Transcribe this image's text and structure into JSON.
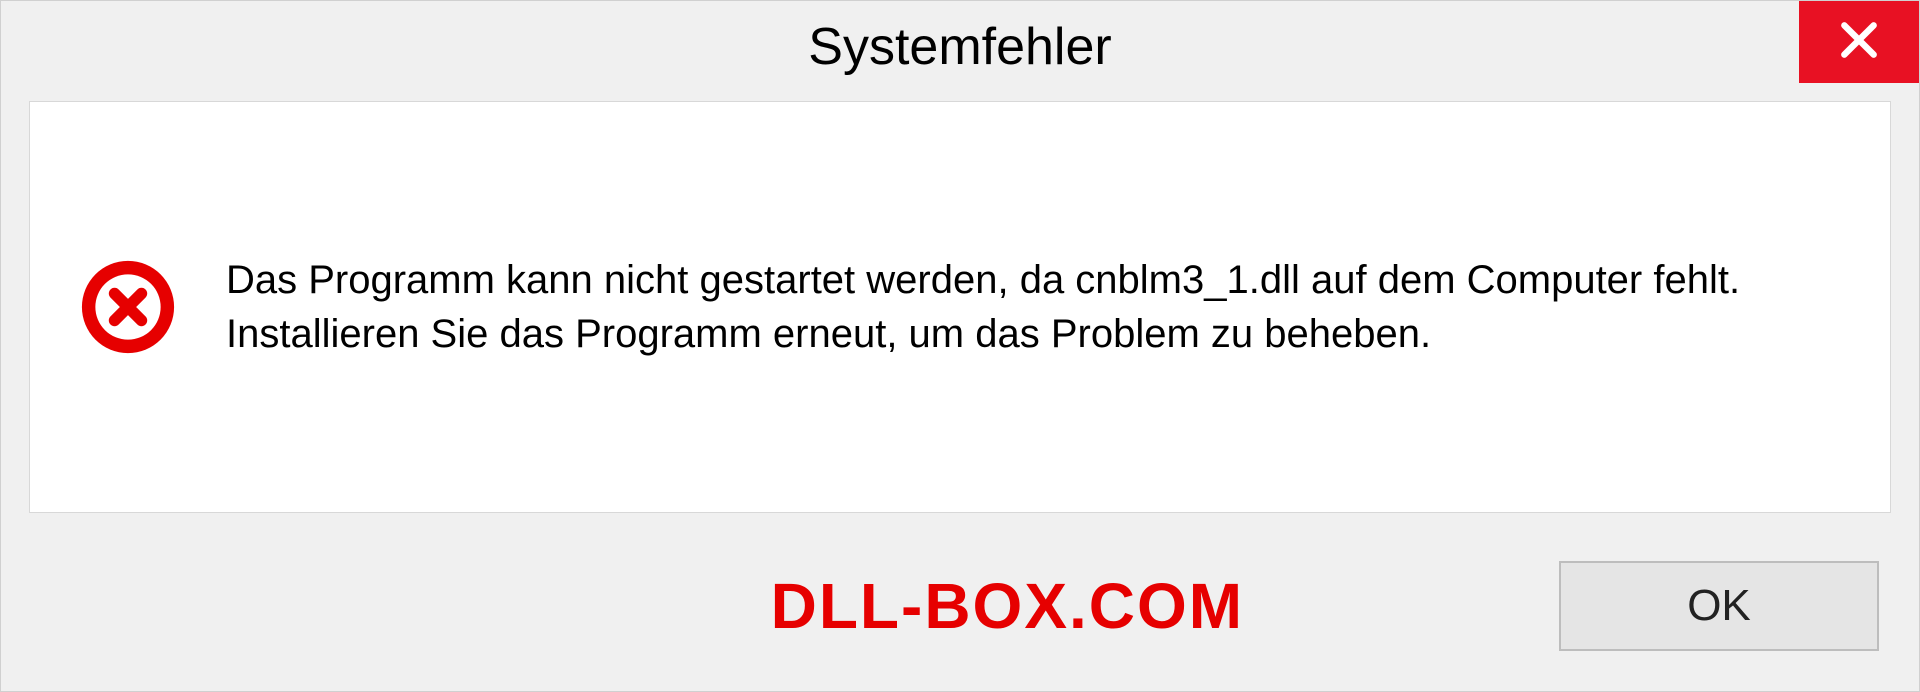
{
  "dialog": {
    "title": "Systemfehler",
    "message": "Das Programm kann nicht gestartet werden, da cnblm3_1.dll auf dem Computer fehlt. Installieren Sie das Programm erneut, um das Problem zu beheben.",
    "ok_label": "OK"
  },
  "watermark": "DLL-BOX.COM",
  "icons": {
    "close": "close-icon",
    "error": "error-icon"
  },
  "colors": {
    "close_bg": "#e81123",
    "error_red": "#e60000",
    "dialog_bg": "#f0f0f0",
    "content_bg": "#ffffff"
  }
}
